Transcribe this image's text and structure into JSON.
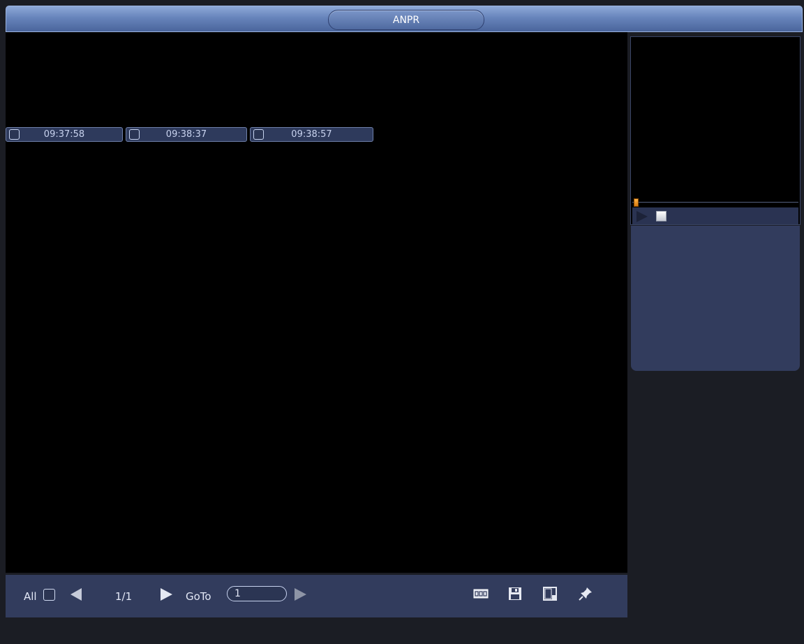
{
  "window": {
    "title": "ANPR"
  },
  "thumbnails": [
    {
      "time": "09:37:58"
    },
    {
      "time": "09:38:37"
    },
    {
      "time": "09:38:57"
    }
  ],
  "preview": {
    "progress": 0.01
  },
  "pagination": {
    "all_label": "All",
    "page_text": "1/1",
    "goto_label": "GoTo",
    "goto_value": "1"
  },
  "toolbar_icons": [
    "ocr-icon",
    "save-icon",
    "export-icon",
    "pin-icon"
  ],
  "colors": {
    "accent": "#323c5d",
    "title": "#6784bb"
  }
}
